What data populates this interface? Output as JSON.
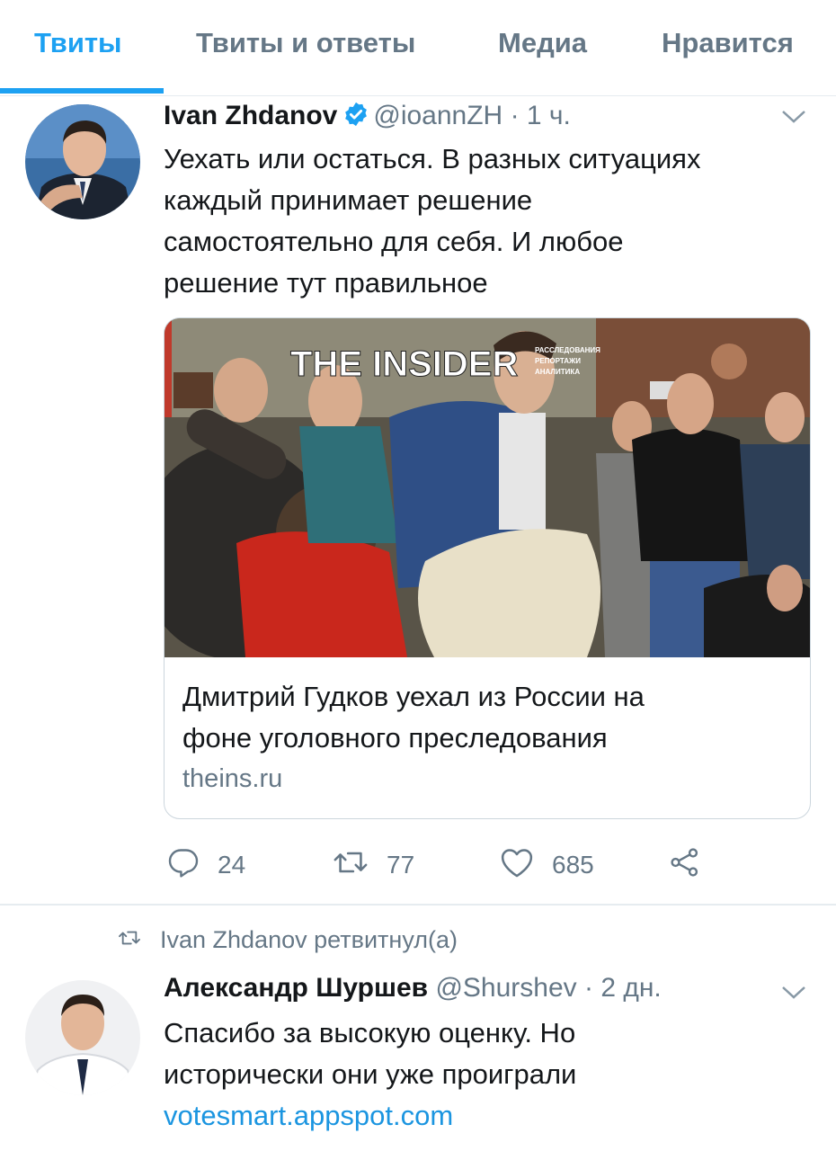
{
  "tabs": [
    {
      "label": "Твиты",
      "active": true
    },
    {
      "label": "Твиты и ответы",
      "active": false
    },
    {
      "label": "Медиа",
      "active": false
    },
    {
      "label": "Нравится",
      "active": false
    }
  ],
  "tweet1": {
    "name": "Ivan Zhdanov",
    "handle": "@ioannZH",
    "dot": "·",
    "time": "1 ч.",
    "verified": true,
    "text_lines": [
      "Уехать или остаться. В разных ситуациях",
      "каждый принимает решение",
      "самостоятельно для себя. И любое",
      "решение тут правильное"
    ],
    "card": {
      "image_logo": "THE INSIDER",
      "image_tagline": [
        "РАССЛЕДОВАНИЯ",
        "РЕПОРТАЖИ",
        "АНАЛИТИКА"
      ],
      "title_lines": [
        "Дмитрий Гудков уехал из России на",
        "фоне уголовного преследования"
      ],
      "domain": "theins.ru"
    },
    "actions": {
      "replies": "24",
      "retweets": "77",
      "likes": "685"
    }
  },
  "retweet_notice": {
    "text": "Ivan Zhdanov ретвитнул(а)"
  },
  "tweet2": {
    "name": "Александр Шуршев",
    "handle": "@Shurshev",
    "dot": "·",
    "time": "2 дн.",
    "text_lines": [
      "Спасибо за высокую оценку. Но",
      "исторически они уже проиграли"
    ],
    "link": "votesmart.appspot.com"
  },
  "colors": {
    "accent": "#1da1f2",
    "muted": "#657786",
    "link": "#1b95e0",
    "text": "#14171a",
    "border": "#e6ecf0"
  },
  "icons": [
    "verified-badge-icon",
    "chevron-down-icon",
    "reply-icon",
    "retweet-icon",
    "like-icon",
    "share-icon"
  ]
}
